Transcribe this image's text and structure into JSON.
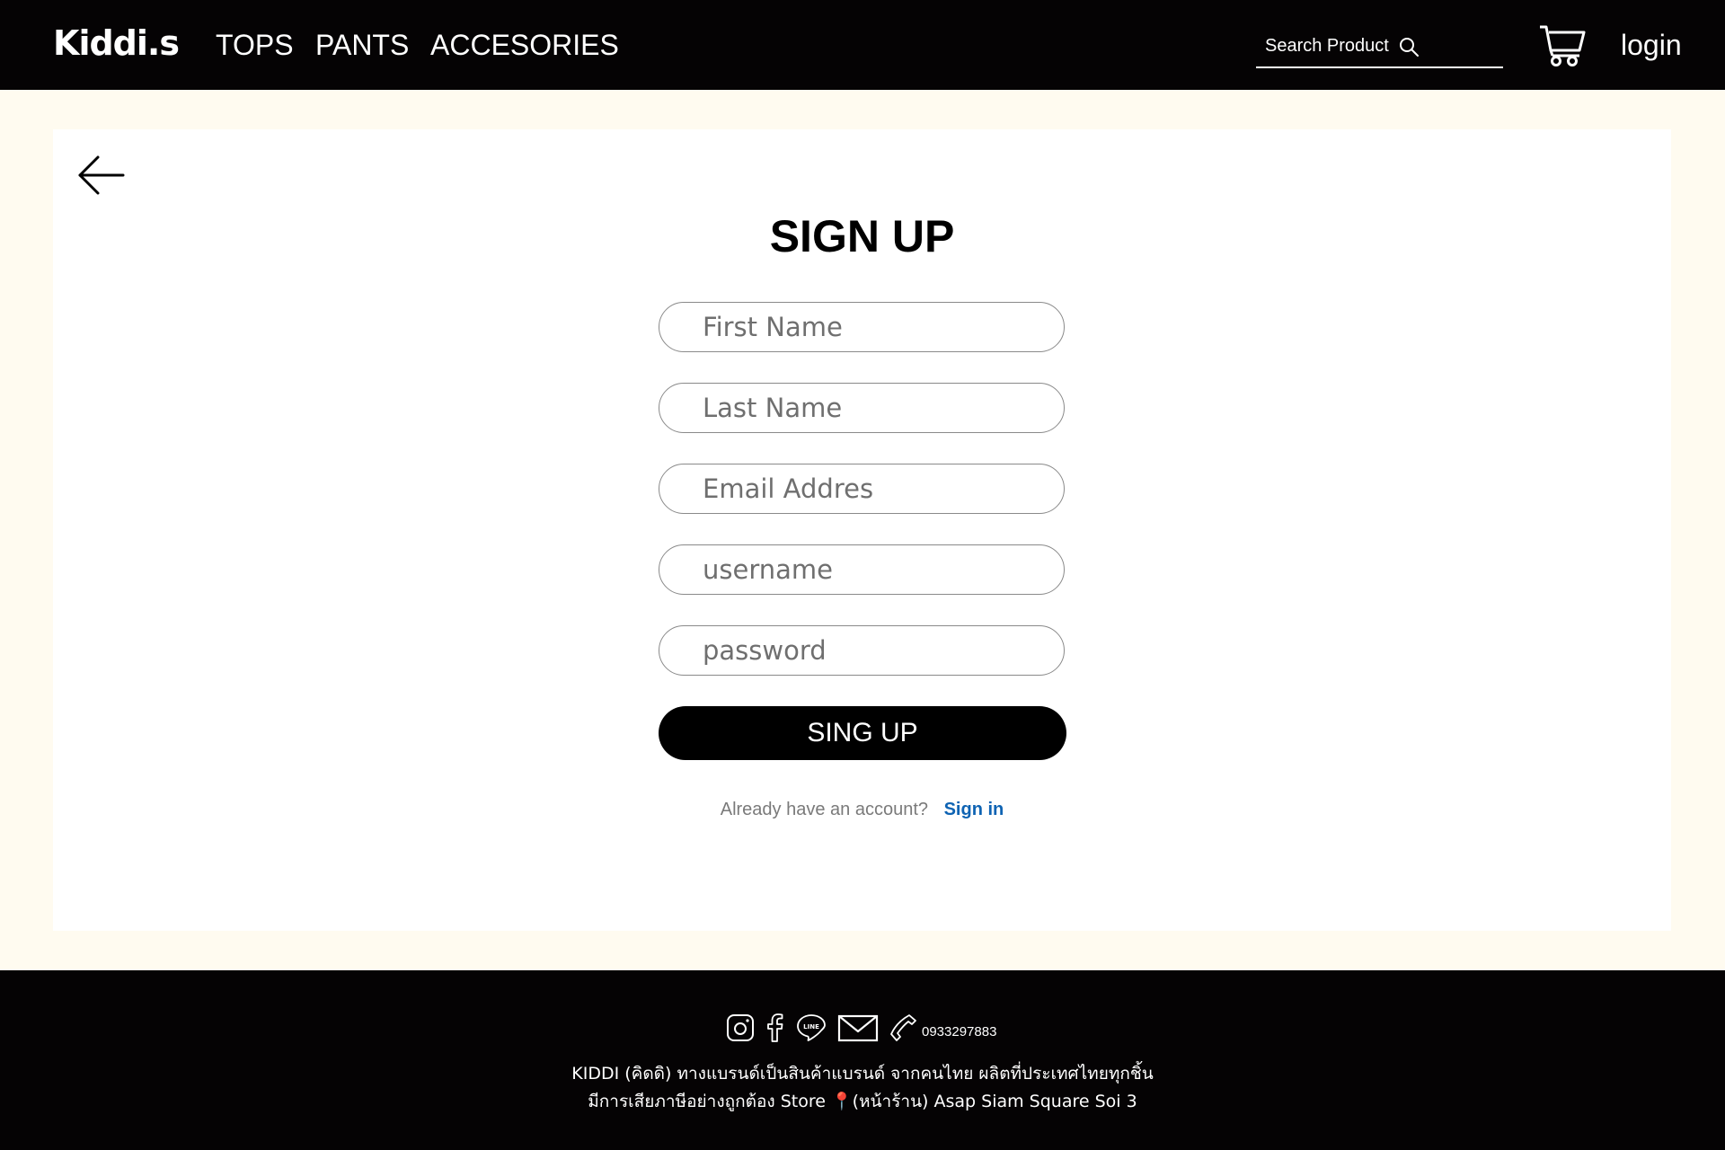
{
  "header": {
    "logo": "Kiddi.s",
    "nav": [
      "TOPS",
      "PANTS",
      "ACCESORIES"
    ],
    "search_placeholder": "Search Product",
    "login_label": "login"
  },
  "signup": {
    "title": "SIGN UP",
    "fields": {
      "first_name": "First Name",
      "last_name": "Last Name",
      "email": "Email Addres",
      "username": "username",
      "password": "password"
    },
    "submit_label": "SING UP",
    "account_prompt": "Already have an account?",
    "signin_label": "Sign in"
  },
  "footer": {
    "phone": "0933297883",
    "line1": "KIDDI (คิดดิ) ทางแบรนด์เป็นสินค้าแบรนด์ จากคนไทย ผลิตที่ประเทศไทยทุกชิ้น",
    "line2": "มีการเสียภาษีอย่างถูกต้อง Store 📍(หน้าร้าน) Asap Siam Square Soi 3",
    "icons": [
      "instagram-icon",
      "facebook-icon",
      "line-icon",
      "mail-icon",
      "phone-icon"
    ]
  },
  "colors": {
    "header_bg": "#050304",
    "page_bg": "#fffbf0",
    "link": "#0e63b3"
  }
}
